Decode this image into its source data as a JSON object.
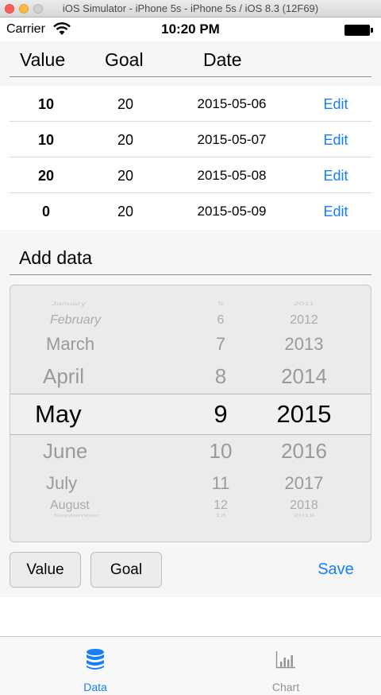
{
  "simulator": {
    "title": "iOS Simulator - iPhone 5s - iPhone 5s / iOS 8.3 (12F69)"
  },
  "status_bar": {
    "carrier": "Carrier",
    "time": "10:20 PM"
  },
  "table": {
    "headers": {
      "value": "Value",
      "goal": "Goal",
      "date": "Date"
    },
    "rows": [
      {
        "value": "10",
        "goal": "20",
        "date": "2015-05-06",
        "action": "Edit"
      },
      {
        "value": "10",
        "goal": "20",
        "date": "2015-05-07",
        "action": "Edit"
      },
      {
        "value": "20",
        "goal": "20",
        "date": "2015-05-08",
        "action": "Edit"
      },
      {
        "value": "0",
        "goal": "20",
        "date": "2015-05-09",
        "action": "Edit"
      }
    ]
  },
  "add_data": {
    "title": "Add data",
    "picker": {
      "months": [
        "January",
        "February",
        "March",
        "April",
        "May",
        "June",
        "July",
        "August",
        "September"
      ],
      "days": [
        "5",
        "6",
        "7",
        "8",
        "9",
        "10",
        "11",
        "12",
        "13"
      ],
      "years": [
        "2011",
        "2012",
        "2013",
        "2014",
        "2015",
        "2016",
        "2017",
        "2018",
        "2019"
      ],
      "selected": {
        "month": "May",
        "day": "9",
        "year": "2015"
      }
    },
    "buttons": {
      "value": "Value",
      "goal": "Goal",
      "save": "Save"
    }
  },
  "tabbar": {
    "tabs": [
      {
        "label": "Data",
        "icon": "database-icon",
        "selected": true
      },
      {
        "label": "Chart",
        "icon": "bar-chart-icon",
        "selected": false
      }
    ]
  },
  "colors": {
    "accent": "#157efb",
    "section_bg": "#f6f6f6",
    "picker_bg": "#ebebeb"
  }
}
